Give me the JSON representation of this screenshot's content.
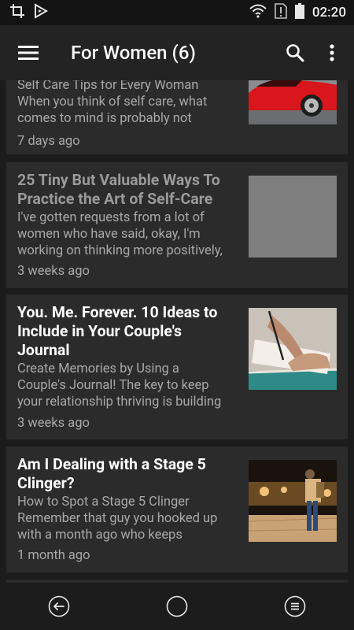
{
  "status_bar": {
    "time": "02:20"
  },
  "app_bar": {
    "title": "For Women (6)"
  },
  "articles": [
    {
      "title": "",
      "excerpt_lines": [
        "Self Care Tips for Every Woman",
        "When you think of self care, what",
        "comes to mind is probably not"
      ],
      "date": "7 days ago",
      "thumbnail": "red-sports-car-image"
    },
    {
      "title_lines": [
        "25 Tiny But Valuable Ways To",
        "Practice the Art of Self-Care"
      ],
      "excerpt_lines": [
        "I've gotten requests from a lot of",
        "women who have said, okay, I'm",
        "working on thinking more positively,"
      ],
      "date": "3 weeks ago",
      "thumbnail": "gray-placeholder-image"
    },
    {
      "title_lines": [
        "You. Me. Forever. 10 Ideas to",
        "Include in Your Couple's",
        "Journal"
      ],
      "excerpt_lines": [
        "Create Memories by Using a",
        "Couple's Journal! The key to keep",
        "your relationship thriving is building"
      ],
      "date": "3 weeks ago",
      "thumbnail": "hand-writing-journal-image"
    },
    {
      "title_lines": [
        "Am I Dealing with a Stage 5",
        "Clinger?"
      ],
      "excerpt_lines": [
        "How to Spot a Stage 5 Clinger",
        "Remember that guy you hooked up",
        "with a month ago who keeps"
      ],
      "date": "1 month ago",
      "thumbnail": "man-with-phone-image"
    }
  ],
  "colors": {
    "title_unread": "#ffffff",
    "title_read": "#9a9a9a",
    "card_bg": "#2b2b2b"
  }
}
